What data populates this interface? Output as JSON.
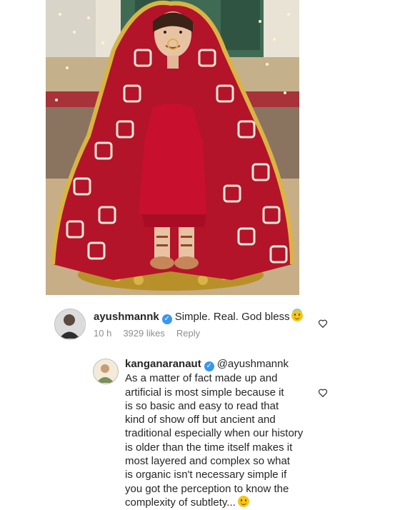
{
  "post": {
    "image_alt": "Photo"
  },
  "comments": [
    {
      "username": "ayushmannk",
      "text": "Simple. Real. God bless",
      "emoji": "smiling-face-with-halo",
      "time": "10 h",
      "likes": "3929 likes",
      "reply_label": "Reply"
    },
    {
      "username": "kanganaranaut",
      "mention": "@ayushmannk",
      "lines": [
        "As a matter of fact made up and",
        "artificial is most simple because it",
        "is so basic and easy to read that",
        "kind of show off but ancient and",
        "traditional especially when our history",
        "is older than the time itself makes it",
        "most layered and complex so what",
        "is organic isn't necessary simple if",
        "you got the perception to know the",
        "complexity of subtlety..."
      ],
      "emoji": "smiling-face"
    }
  ],
  "colors": {
    "verified": "#3897f0",
    "meta_gray": "#8e8e8e",
    "shawl_red": "#b3142a"
  }
}
